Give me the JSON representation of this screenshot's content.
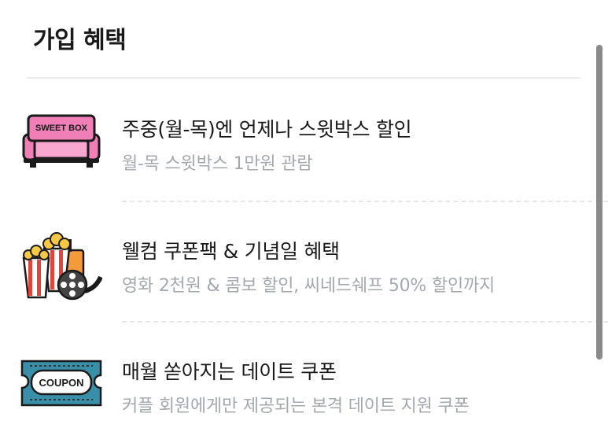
{
  "section": {
    "title": "가입 혜택"
  },
  "benefits": [
    {
      "icon": "sweet-box-sofa-icon",
      "icon_text": "SWEET BOX",
      "title": "주중(월-목)엔 언제나 스윗박스 할인",
      "description": "월-목 스윗박스 1만원 관람"
    },
    {
      "icon": "popcorn-film-reel-icon",
      "title": "웰컴 쿠폰팩 & 기념일 혜택",
      "description": "영화 2천원 & 콤보 할인, 씨네드쉐프 50% 할인까지"
    },
    {
      "icon": "coupon-ticket-icon",
      "icon_text": "COUPON",
      "title": "매월 쏟아지는 데이트 쿠폰",
      "description": "커플 회원에게만 제공되는 본격 데이트 지원 쿠폰"
    }
  ],
  "colors": {
    "title_text": "#1a1a1a",
    "description_text": "#a4a8ae",
    "sofa_pink": "#ef7fb6",
    "coupon_teal": "#3a8fa8",
    "popcorn_red": "#e0443a",
    "scrollbar": "#8a8a8a"
  }
}
